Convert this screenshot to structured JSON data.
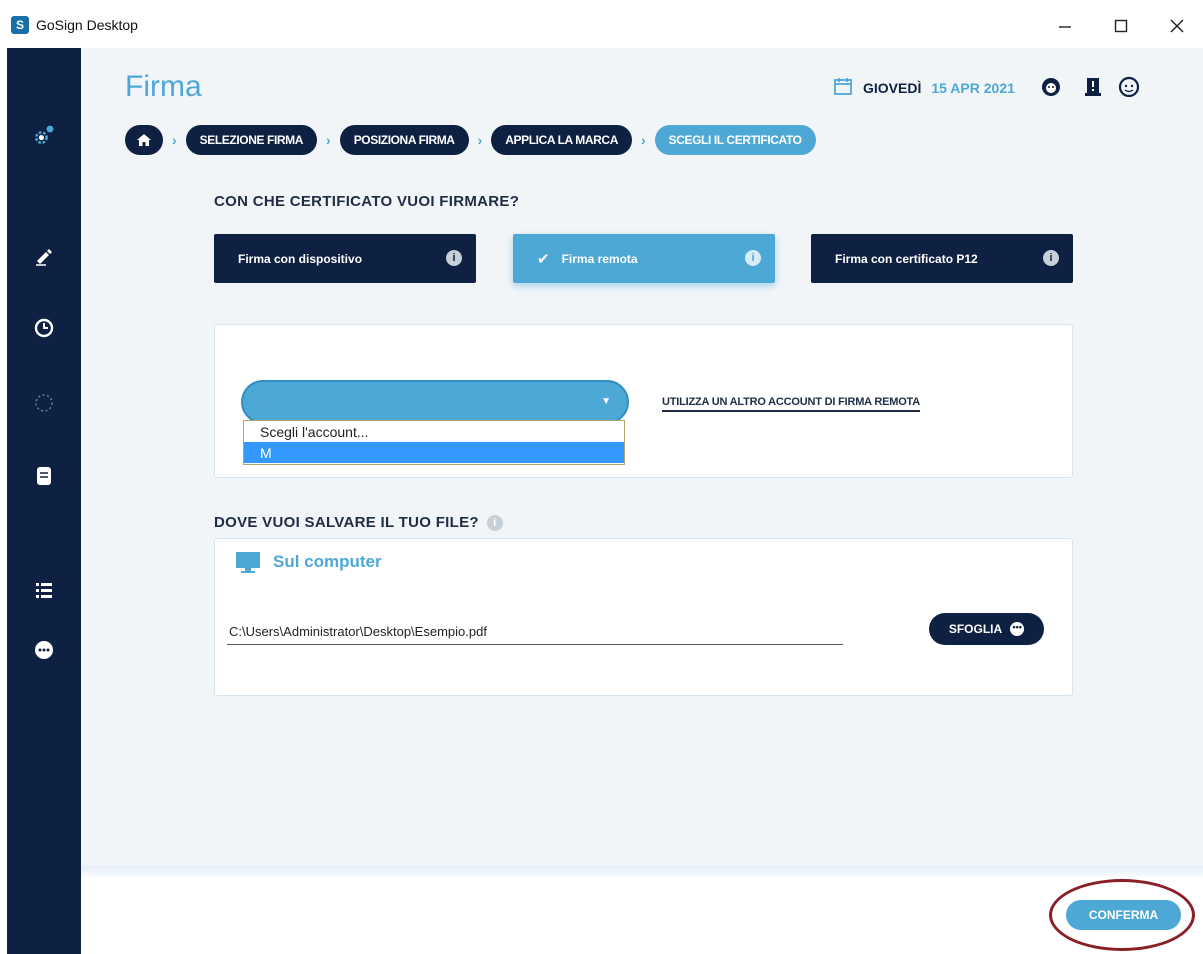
{
  "window": {
    "title": "GoSign Desktop",
    "app_icon": "S"
  },
  "header": {
    "page_title": "Firma",
    "date_day": "GIOVEDÌ",
    "date_value": "15 APR 2021"
  },
  "breadcrumbs": [
    "SELEZIONE FIRMA",
    "POSIZIONA FIRMA",
    "APPLICA LA MARCA",
    "SCEGLI IL CERTIFICATO"
  ],
  "certificate": {
    "question": "CON CHE CERTIFICATO VUOI FIRMARE?",
    "options": [
      "Firma con dispositivo",
      "Firma remota",
      "Firma con certificato P12"
    ],
    "selected": "Firma remota"
  },
  "account": {
    "dropdown_options": [
      "Scegli l'account...",
      "M"
    ],
    "highlighted_option": "M",
    "alt_link": "UTILIZZA UN ALTRO ACCOUNT DI FIRMA REMOTA"
  },
  "save": {
    "question": "DOVE VUOI SALVARE IL TUO FILE?",
    "location_label": "Sul computer",
    "path": "C:\\Users\\Administrator\\Desktop\\Esempio.pdf",
    "browse_label": "SFOGLIA"
  },
  "footer": {
    "confirm_label": "CONFERMA"
  },
  "colors": {
    "navy": "#0e2142",
    "accent": "#4ea8d6",
    "highlight_ring": "#8b1f26"
  }
}
